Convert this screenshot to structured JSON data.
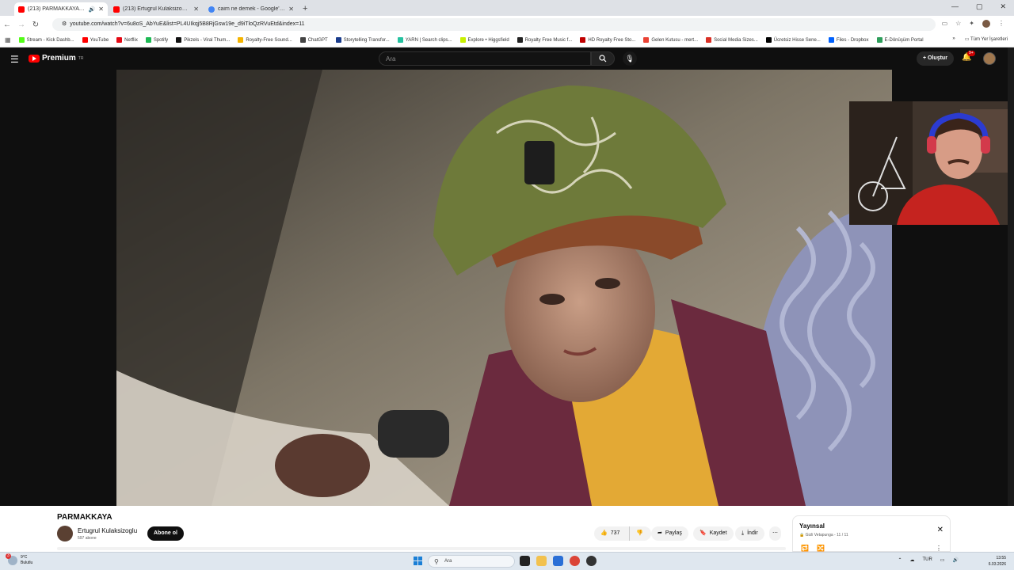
{
  "browser": {
    "tabs": [
      {
        "title": "(213) PARMAKKAYA - YouT...",
        "active": true,
        "color": "#ff0000"
      },
      {
        "title": "(213) Ertugrul Kulaksizoglu - Yo...",
        "active": false,
        "color": "#ff0000"
      },
      {
        "title": "caim ne demek - Google'da Ar...",
        "active": false,
        "color": "#4285f4"
      }
    ],
    "new_tab": "+",
    "url": "youtube.com/watch?v=6u8oS_AbYuE&list=PL4UIkqj5B8RjGsw19e_d9iTloQzRVuEtd&index=11",
    "bookmarks": [
      {
        "label": "Stream - Kick Dashb...",
        "color": "#53fc18"
      },
      {
        "label": "YouTube",
        "color": "#ff0000"
      },
      {
        "label": "Netflix",
        "color": "#e50914"
      },
      {
        "label": "Spotify",
        "color": "#1db954"
      },
      {
        "label": "Pikzels - Viral Thum...",
        "color": "#111111"
      },
      {
        "label": "Royalty-Free Sound...",
        "color": "#f5b400"
      },
      {
        "label": "ChatGPT",
        "color": "#444444"
      },
      {
        "label": "Storytelling Transfor...",
        "color": "#1a3c8c"
      },
      {
        "label": "YARN | Search clips...",
        "color": "#25c2a0"
      },
      {
        "label": "Explore • Higgsfield",
        "color": "#c8f000"
      },
      {
        "label": "Royalty Free Music f...",
        "color": "#222222"
      },
      {
        "label": "HD Royalty Free Sto...",
        "color": "#c00000"
      },
      {
        "label": "Gelen Kutusu - mert...",
        "color": "#ea4335"
      },
      {
        "label": "Social Media Sizes...",
        "color": "#d93025"
      },
      {
        "label": "Ücretsiz Hisse Sene...",
        "color": "#000000"
      },
      {
        "label": "Files - Dropbox",
        "color": "#0061fe"
      },
      {
        "label": "E-Dönüşüm Portal",
        "color": "#2e9e5b"
      }
    ],
    "bookmarks_more": "»",
    "all_bookmarks": "Tüm Yer İşaretleri"
  },
  "youtube": {
    "logo": "Premium",
    "logo_sup": "TR",
    "search_placeholder": "Ara",
    "create_label": "Oluştur",
    "notif_badge": "9+",
    "video": {
      "title": "PARMAKKAYA",
      "channel": "Ertugrul Kulaksizoglu",
      "subscribers": "597 abone",
      "subscribe_label": "Abone ol",
      "likes": "737",
      "share_label": "Paylaş",
      "save_label": "Kaydet",
      "download_label": "İndir"
    },
    "playlist": {
      "title": "Yayınsal",
      "owner": "Gizli Vetapunga",
      "position": "11 / 11"
    }
  },
  "taskbar": {
    "weather_temp": "9°C",
    "weather_desc": "Bulutlu",
    "weather_badge": "3",
    "search_placeholder": "Ara",
    "lang": "TUR",
    "time": "13:55",
    "date": "6.03.2026"
  }
}
